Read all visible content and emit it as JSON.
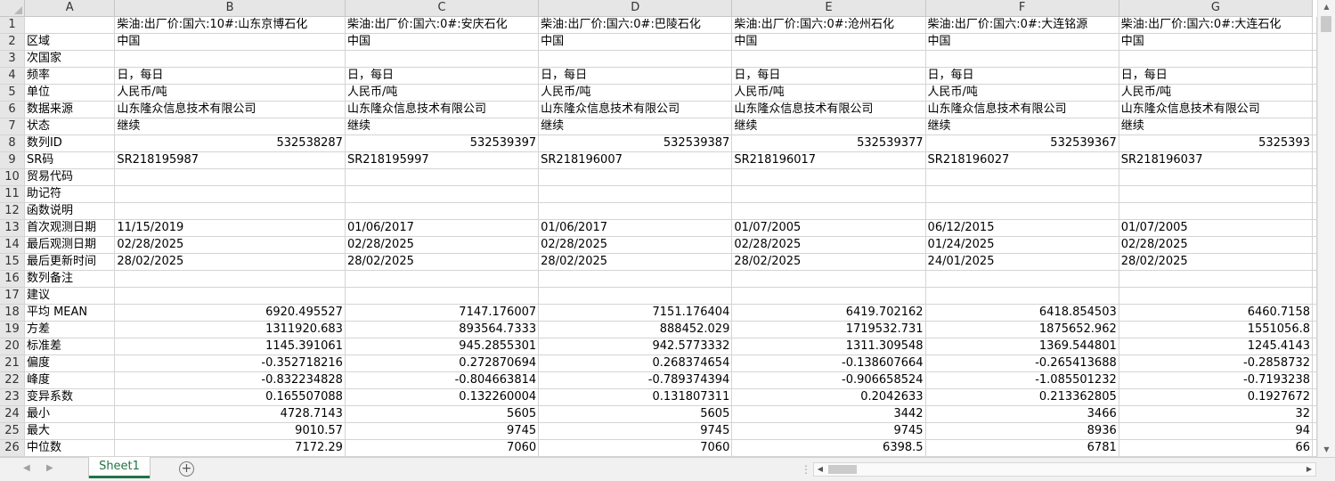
{
  "columns": [
    "A",
    "B",
    "C",
    "D",
    "E",
    "F",
    "G"
  ],
  "rows": [
    {
      "n": "1",
      "cells": [
        "",
        "柴油:出厂价:国六:10#:山东京博石化",
        "柴油:出厂价:国六:0#:安庆石化",
        "柴油:出厂价:国六:0#:巴陵石化",
        "柴油:出厂价:国六:0#:沧州石化",
        "柴油:出厂价:国六:0#:大连铭源",
        "柴油:出厂价:国六:0#:大连石化"
      ]
    },
    {
      "n": "2",
      "cells": [
        "区域",
        "中国",
        "中国",
        "中国",
        "中国",
        "中国",
        "中国"
      ]
    },
    {
      "n": "3",
      "cells": [
        "次国家",
        "",
        "",
        "",
        "",
        "",
        ""
      ]
    },
    {
      "n": "4",
      "cells": [
        "频率",
        "日，每日",
        "日，每日",
        "日，每日",
        "日，每日",
        "日，每日",
        "日，每日"
      ]
    },
    {
      "n": "5",
      "cells": [
        "单位",
        "人民币/吨",
        "人民币/吨",
        "人民币/吨",
        "人民币/吨",
        "人民币/吨",
        "人民币/吨"
      ]
    },
    {
      "n": "6",
      "cells": [
        "数据来源",
        "山东隆众信息技术有限公司",
        "山东隆众信息技术有限公司",
        "山东隆众信息技术有限公司",
        "山东隆众信息技术有限公司",
        "山东隆众信息技术有限公司",
        "山东隆众信息技术有限公司"
      ]
    },
    {
      "n": "7",
      "cells": [
        "状态",
        "继续",
        "继续",
        "继续",
        "继续",
        "继续",
        "继续"
      ]
    },
    {
      "n": "8",
      "cells": [
        "数列ID",
        "532538287",
        "532539397",
        "532539387",
        "532539377",
        "532539367",
        "5325393"
      ],
      "numeric": true
    },
    {
      "n": "9",
      "cells": [
        "SR码",
        "SR218195987",
        "SR218195997",
        "SR218196007",
        "SR218196017",
        "SR218196027",
        "SR218196037"
      ]
    },
    {
      "n": "10",
      "cells": [
        "贸易代码",
        "",
        "",
        "",
        "",
        "",
        ""
      ]
    },
    {
      "n": "11",
      "cells": [
        "助记符",
        "",
        "",
        "",
        "",
        "",
        ""
      ]
    },
    {
      "n": "12",
      "cells": [
        "函数说明",
        "",
        "",
        "",
        "",
        "",
        ""
      ]
    },
    {
      "n": "13",
      "cells": [
        "首次观测日期",
        "11/15/2019",
        "01/06/2017",
        "01/06/2017",
        "01/07/2005",
        "06/12/2015",
        "01/07/2005"
      ]
    },
    {
      "n": "14",
      "cells": [
        "最后观测日期",
        "02/28/2025",
        "02/28/2025",
        "02/28/2025",
        "02/28/2025",
        "01/24/2025",
        "02/28/2025"
      ]
    },
    {
      "n": "15",
      "cells": [
        "最后更新时间",
        "28/02/2025",
        "28/02/2025",
        "28/02/2025",
        "28/02/2025",
        "24/01/2025",
        "28/02/2025"
      ]
    },
    {
      "n": "16",
      "cells": [
        "数列备注",
        "",
        "",
        "",
        "",
        "",
        ""
      ]
    },
    {
      "n": "17",
      "cells": [
        "建议",
        "",
        "",
        "",
        "",
        "",
        ""
      ]
    },
    {
      "n": "18",
      "cells": [
        "平均 MEAN",
        "6920.495527",
        "7147.176007",
        "7151.176404",
        "6419.702162",
        "6418.854503",
        "6460.7158"
      ],
      "numeric": true
    },
    {
      "n": "19",
      "cells": [
        "方差",
        "1311920.683",
        "893564.7333",
        "888452.029",
        "1719532.731",
        "1875652.962",
        "1551056.8"
      ],
      "numeric": true
    },
    {
      "n": "20",
      "cells": [
        "标准差",
        "1145.391061",
        "945.2855301",
        "942.5773332",
        "1311.309548",
        "1369.544801",
        "1245.4143"
      ],
      "numeric": true
    },
    {
      "n": "21",
      "cells": [
        "偏度",
        "-0.352718216",
        "0.272870694",
        "0.268374654",
        "-0.138607664",
        "-0.265413688",
        "-0.2858732"
      ],
      "numeric": true
    },
    {
      "n": "22",
      "cells": [
        "峰度",
        "-0.832234828",
        "-0.804663814",
        "-0.789374394",
        "-0.906658524",
        "-1.085501232",
        "-0.7193238"
      ],
      "numeric": true
    },
    {
      "n": "23",
      "cells": [
        "变异系数",
        "0.165507088",
        "0.132260004",
        "0.131807311",
        "0.2042633",
        "0.213362805",
        "0.1927672"
      ],
      "numeric": true
    },
    {
      "n": "24",
      "cells": [
        "最小",
        "4728.7143",
        "5605",
        "5605",
        "3442",
        "3466",
        "32"
      ],
      "numeric": true
    },
    {
      "n": "25",
      "cells": [
        "最大",
        "9010.57",
        "9745",
        "9745",
        "9745",
        "8936",
        "94"
      ],
      "numeric": true
    },
    {
      "n": "26",
      "cells": [
        "中位数",
        "7172.29",
        "7060",
        "7060",
        "6398.5",
        "6781",
        "66"
      ],
      "numeric": true
    }
  ],
  "sheet_tabs": [
    {
      "label": "Sheet1",
      "active": true
    }
  ],
  "icons": {
    "add_sheet": "plus-circle-icon",
    "scroll_up": "arrow-up-icon",
    "scroll_down": "arrow-down-icon",
    "scroll_left": "arrow-left-icon",
    "scroll_right": "arrow-right-icon"
  },
  "colors": {
    "active_tab": "#217346",
    "header_bg": "#e6e6e6",
    "gridline": "#d4d4d4"
  }
}
